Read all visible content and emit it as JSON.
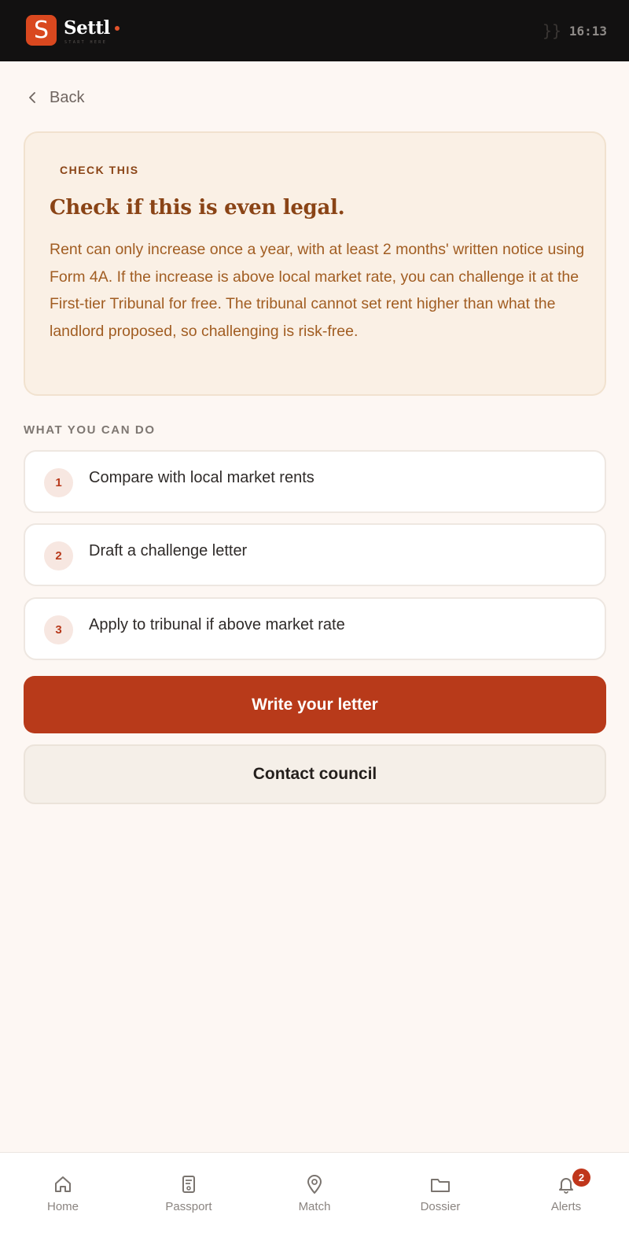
{
  "app": {
    "name": "Settl",
    "logo_letter": "S",
    "tagline": "START HERE",
    "status_separator": "}}",
    "clock": "16:13"
  },
  "nav": {
    "back_label": "Back"
  },
  "info_card": {
    "kicker": "CHECK THIS",
    "title": "Check if this is even legal.",
    "body": "Rent can only increase once a year, with at least 2 months' written notice using Form 4A. If the increase is above local market rate, you can challenge it at the First-tier Tribunal for free. The tribunal cannot set rent higher than what the landlord proposed, so challenging is risk-free."
  },
  "actions": {
    "section_label": "WHAT YOU CAN DO",
    "steps": [
      {
        "number": "1",
        "label": "Compare with local market rents"
      },
      {
        "number": "2",
        "label": "Draft a challenge letter"
      },
      {
        "number": "3",
        "label": "Apply to tribunal if above market rate"
      }
    ],
    "primary_button": "Write your letter",
    "secondary_button": "Contact council"
  },
  "tabbar": {
    "items": [
      {
        "label": "Home",
        "icon": "home-icon"
      },
      {
        "label": "Passport",
        "icon": "passport-icon"
      },
      {
        "label": "Match",
        "icon": "map-pin-icon"
      },
      {
        "label": "Dossier",
        "icon": "folder-icon"
      },
      {
        "label": "Alerts",
        "icon": "bell-icon",
        "badge": "2"
      }
    ]
  },
  "colors": {
    "brand": "#d9481f",
    "primary_button": "#b83a1a",
    "card_accent": "#8a4416",
    "background": "#fdf7f3"
  }
}
